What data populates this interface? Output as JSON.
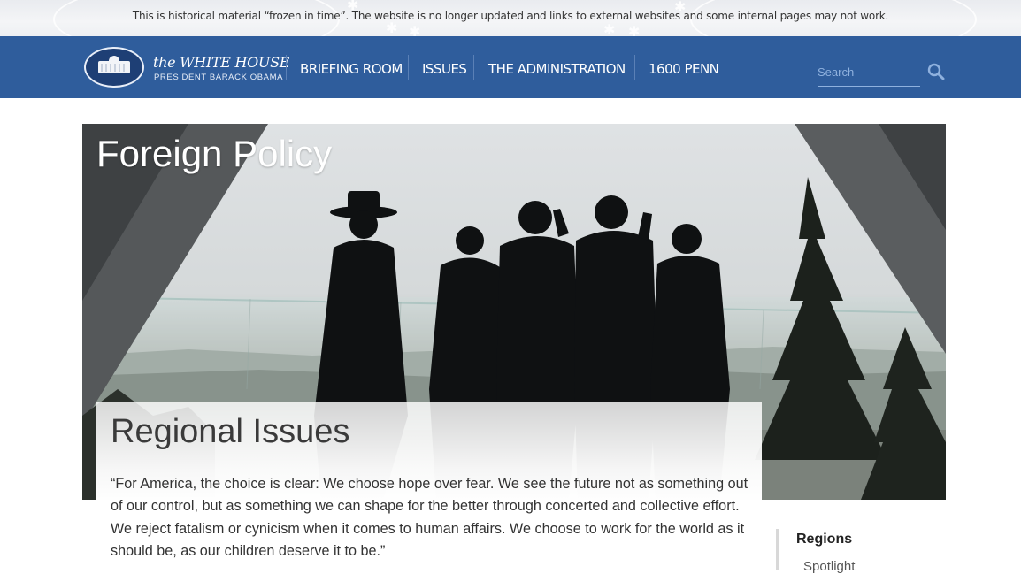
{
  "archive_notice": "This is historical material “frozen in time”. The website is no longer updated and links to external websites and some internal pages may not work.",
  "logo": {
    "title": "the WHITE HOUSE",
    "subtitle": "PRESIDENT BARACK OBAMA"
  },
  "nav": {
    "items": [
      {
        "label": "BRIEFING ROOM"
      },
      {
        "label": "ISSUES"
      },
      {
        "label": "THE ADMINISTRATION"
      },
      {
        "label": "1600 PENN"
      }
    ]
  },
  "search": {
    "placeholder": "Search",
    "icon": "search-icon"
  },
  "hero": {
    "title": "Foreign Policy"
  },
  "main": {
    "heading": "Regional Issues",
    "quote": "“For America, the choice is clear: We choose hope over fear. We see the future not as something out of our control, but as something we can shape for the better through concerted and collective effort. We reject fatalism or cynicism when it comes to human affairs. We choose to work for the world as it should be, as our children deserve it to be.”"
  },
  "sidebar": {
    "heading": "Regions",
    "items": [
      {
        "label": "Spotlight"
      }
    ]
  },
  "colors": {
    "nav_background": "#2f5d9c",
    "search_text": "#8fb1de",
    "body_text": "#333333"
  }
}
